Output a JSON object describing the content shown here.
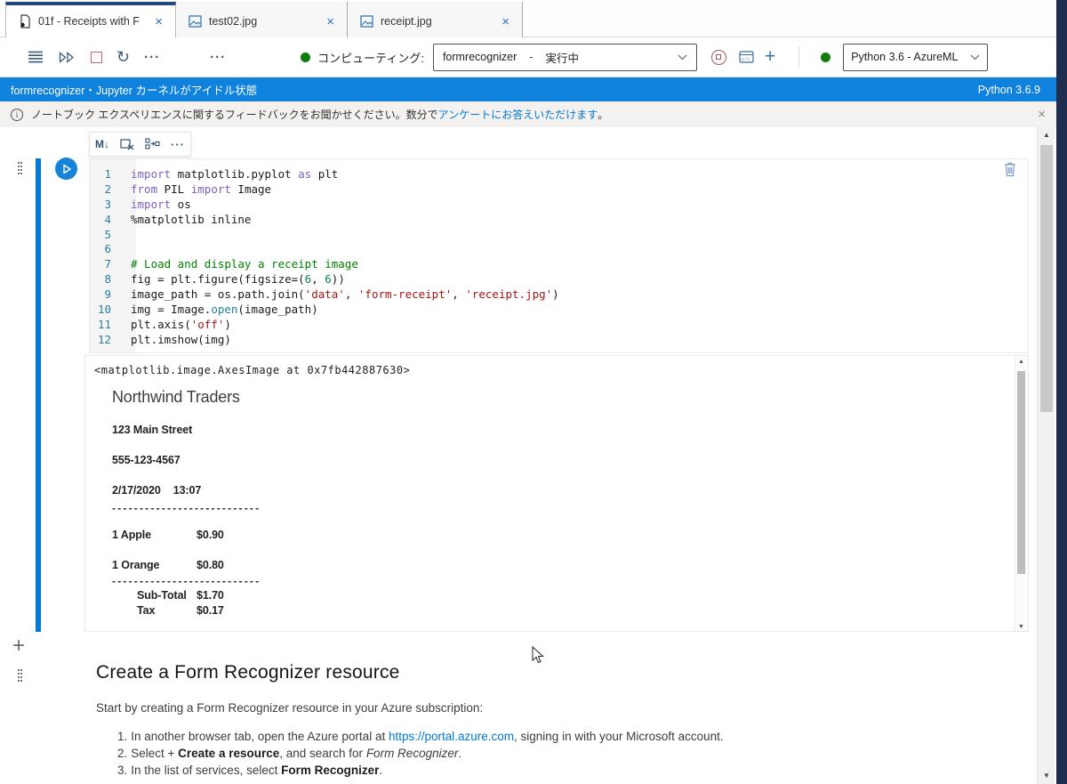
{
  "colors": {
    "accent": "#0078d4",
    "kernel_bar_blue": "#0f82dd",
    "status_green": "#107c10",
    "stop_red": "#a4262c",
    "navy_strip": "#1f2d4e",
    "string_token": "#a31515",
    "comment_token": "#008000",
    "keyword_token": "#7b5fc0"
  },
  "tabs": {
    "items": [
      {
        "label": "01f - Receipts with F",
        "close": "×",
        "active": true
      },
      {
        "label": "test02.jpg",
        "close": "×",
        "active": false
      },
      {
        "label": "receipt.jpg",
        "close": "×",
        "active": false
      }
    ]
  },
  "toolbar": {
    "more_label": "···",
    "more_label_2": "···",
    "restart_glyph": "↻",
    "compute_label": "コンピューティング:",
    "compute_name": "formrecognizer",
    "compute_dash": "-",
    "compute_status": "実行中",
    "add_glyph": "+",
    "kernel_name": "Python 3.6 - AzureML"
  },
  "kernel_bar": {
    "left": "formrecognizer・Jupyter カーネルがアイドル状態",
    "right": "Python 3.6.9"
  },
  "info_bar": {
    "message_prefix": "ノートブック エクスペリエンスに関するフィードバックをお聞かせください。数分で ",
    "link_text": "アンケートにお答えいただけます",
    "message_suffix": "。",
    "close": "×"
  },
  "cell_toolbar": {
    "markdown_label": "M↓",
    "more_label": "···"
  },
  "cell": {
    "code": {
      "lines": [
        {
          "num": "1",
          "tokens": [
            [
              "k",
              "import"
            ],
            [
              "p",
              " matplotlib.pyplot "
            ],
            [
              "k",
              "as"
            ],
            [
              "p",
              " plt"
            ]
          ]
        },
        {
          "num": "2",
          "tokens": [
            [
              "k",
              "from"
            ],
            [
              "p",
              " PIL "
            ],
            [
              "k",
              "import"
            ],
            [
              "p",
              " Image"
            ]
          ]
        },
        {
          "num": "3",
          "tokens": [
            [
              "k",
              "import"
            ],
            [
              "p",
              " os"
            ]
          ]
        },
        {
          "num": "4",
          "tokens": [
            [
              "p",
              "%matplotlib inline"
            ]
          ]
        },
        {
          "num": "5",
          "tokens": []
        },
        {
          "num": "6",
          "tokens": []
        },
        {
          "num": "7",
          "tokens": [
            [
              "c",
              "# Load and display a receipt image"
            ]
          ]
        },
        {
          "num": "8",
          "tokens": [
            [
              "p",
              "fig = plt.figure(figsize=("
            ],
            [
              "n",
              "6"
            ],
            [
              "p",
              ", "
            ],
            [
              "n",
              "6"
            ],
            [
              "p",
              "))"
            ]
          ]
        },
        {
          "num": "9",
          "tokens": [
            [
              "p",
              "image_path = os.path.join("
            ],
            [
              "s",
              "'data'"
            ],
            [
              "p",
              ", "
            ],
            [
              "s",
              "'form-receipt'"
            ],
            [
              "p",
              ", "
            ],
            [
              "s",
              "'receipt.jpg'"
            ],
            [
              "p",
              ")"
            ]
          ]
        },
        {
          "num": "10",
          "tokens": [
            [
              "p",
              "img = Image."
            ],
            [
              "f",
              "open"
            ],
            [
              "p",
              "(image_path)"
            ]
          ]
        },
        {
          "num": "11",
          "tokens": [
            [
              "p",
              "plt.axis("
            ],
            [
              "s",
              "'off'"
            ],
            [
              "p",
              ")"
            ]
          ]
        },
        {
          "num": "12",
          "tokens": [
            [
              "p",
              "plt.imshow(img)"
            ]
          ]
        }
      ]
    }
  },
  "output": {
    "repr": "<matplotlib.image.AxesImage at 0x7fb442887630>",
    "receipt": {
      "store": "Northwind Traders",
      "address": "123 Main Street",
      "phone": "555-123-4567",
      "date": "2/17/2020",
      "time": "13:07",
      "divider": "---------------------------",
      "items": [
        {
          "name": "1 Apple",
          "price": "$0.90"
        },
        {
          "name": "1 Orange",
          "price": "$0.80"
        }
      ],
      "subtotal_label": "Sub-Total",
      "subtotal_value": "$1.70",
      "tax_label": "Tax",
      "tax_value": "$0.17"
    }
  },
  "markdown": {
    "heading": "Create a Form Recognizer resource",
    "intro": "Start by creating a Form Recognizer resource in your Azure subscription:",
    "steps": [
      {
        "num": "1.",
        "pre": "In another browser tab, open the Azure portal at ",
        "link": "https://portal.azure.com",
        "post": ", signing in with your Microsoft account."
      },
      {
        "num": "2.",
        "pre": "Select + ",
        "bold": "Create a resource",
        "mid": ", and search for ",
        "italic": "Form Recognizer",
        "post": "."
      },
      {
        "num": "3.",
        "pre": "In the list of services, select ",
        "bold": "Form Recognizer",
        "post": "."
      }
    ]
  }
}
